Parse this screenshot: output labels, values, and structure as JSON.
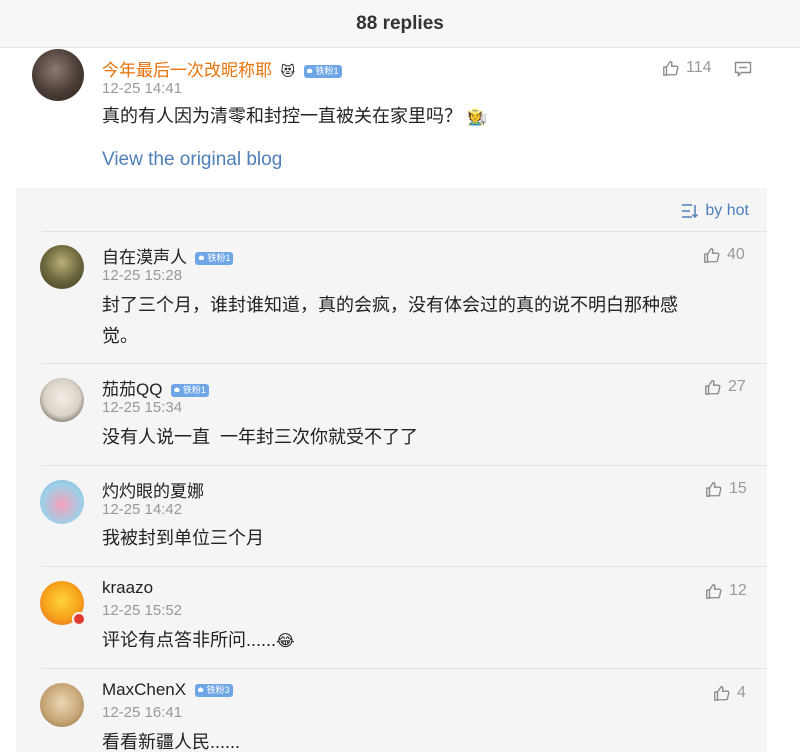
{
  "header": {
    "title": "88 replies"
  },
  "main": {
    "username": "今年最后一次改昵称耶",
    "badge": "铁粉1",
    "time": "12-25 14:41",
    "text": "真的有人因为清零和封控一直被关在家里吗？",
    "text_emoji": "🧑‍🌾",
    "likes": "114",
    "link": "View the original blog",
    "icons": {
      "like": "thumb-up-icon",
      "comment": "comment-icon",
      "heart": "heart-face-icon"
    }
  },
  "sort": {
    "label": "by hot",
    "icon": "sort-icon"
  },
  "replies": [
    {
      "username": "自在漠声人",
      "badge": "铁粉1",
      "time": "12-25 15:28",
      "likes": "40",
      "text_line1": "封了三个月，谁封谁知道，真的会疯，没有体会过的真的说不明白那种感",
      "text_line2": "觉。"
    },
    {
      "username": "茄茄QQ",
      "badge": "铁粉1",
      "time": "12-25 15:34",
      "likes": "27",
      "text": "没有人说一直  一年封三次你就受不了了"
    },
    {
      "username": "灼灼眼的夏娜",
      "time": "12-25 14:42",
      "likes": "15",
      "text": "我被封到单位三个月"
    },
    {
      "username": "kraazo",
      "time": "12-25 15:52",
      "likes": "12",
      "text": "评论有点答非所问......",
      "text_emoji": "😂"
    },
    {
      "username": "MaxChenX",
      "badge": "铁粉3",
      "time": "12-25 16:41",
      "likes": "4",
      "text": "看看新疆人民......"
    }
  ],
  "colors": {
    "username_highlight": "#e8710a",
    "link": "#4e7fb8",
    "badge": "#6ea6e6",
    "panel": "#f5f5f5"
  }
}
